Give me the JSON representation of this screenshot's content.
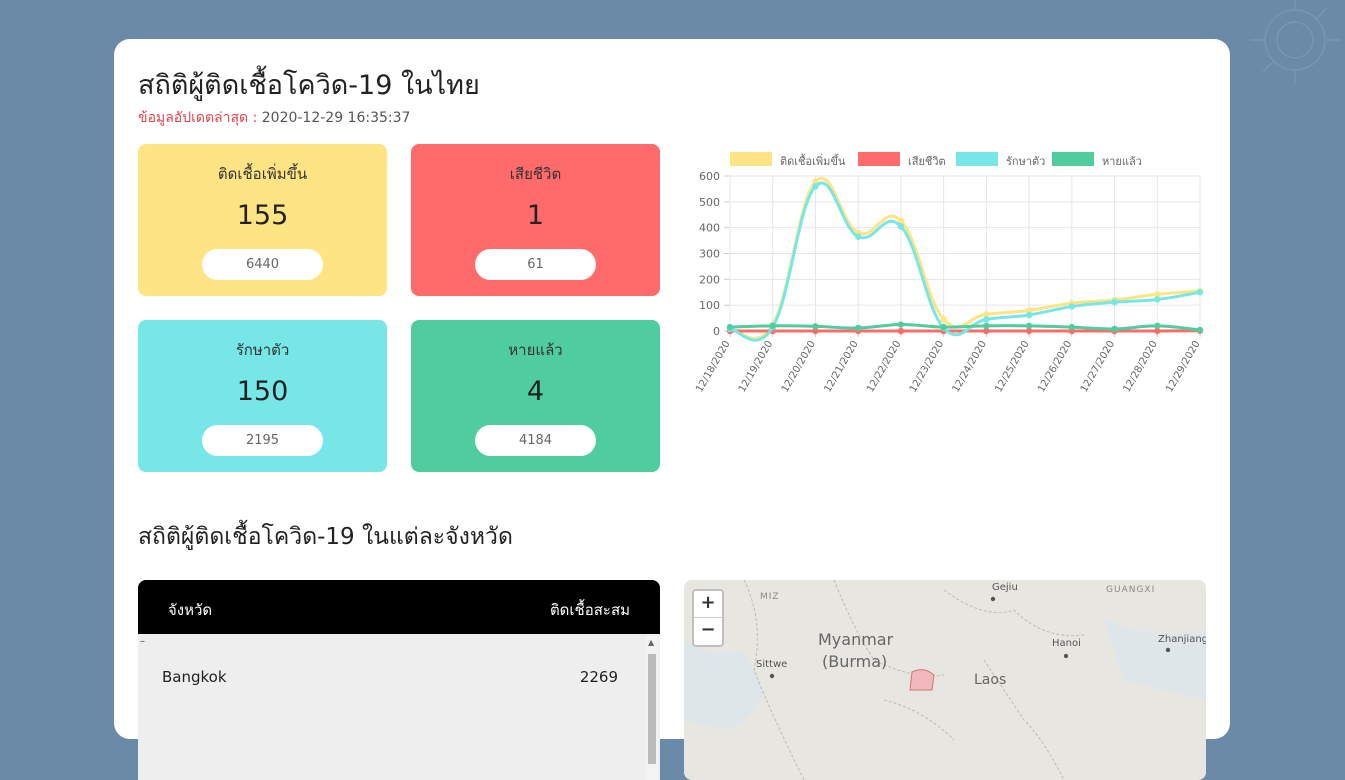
{
  "page": {
    "title": "สถิติผู้ติดเชื้อโควิด-19 ในไทย",
    "updated_label": "ข้อมูลอัปเดตล่าสุด :",
    "updated_value": "2020-12-29 16:35:37"
  },
  "stats": [
    {
      "label": "ติดเชื้อเพิ่มขึ้น",
      "value": "155",
      "total": "6440"
    },
    {
      "label": "เสียชีวิต",
      "value": "1",
      "total": "61"
    },
    {
      "label": "รักษาตัว",
      "value": "150",
      "total": "2195"
    },
    {
      "label": "หายแล้ว",
      "value": "4",
      "total": "4184"
    }
  ],
  "colors": {
    "infected": "#ffe483",
    "deaths": "#ff6b6b",
    "treating": "#76e7e6",
    "recovered": "#50cd9f"
  },
  "chart_data": {
    "type": "line",
    "categories": [
      "12/18/2020",
      "12/19/2020",
      "12/20/2020",
      "12/21/2020",
      "12/22/2020",
      "12/23/2020",
      "12/24/2020",
      "12/25/2020",
      "12/26/2020",
      "12/27/2020",
      "12/28/2020",
      "12/29/2020"
    ],
    "series": [
      {
        "name": "ติดเชื้อเพิ่มขึ้น",
        "color": "#ffe483",
        "values": [
          10,
          25,
          578,
          380,
          427,
          45,
          65,
          80,
          108,
          120,
          142,
          155
        ]
      },
      {
        "name": "เสียชีวิต",
        "color": "#ff6b6b",
        "values": [
          0,
          0,
          0,
          0,
          0,
          0,
          0,
          0,
          0,
          0,
          0,
          1
        ]
      },
      {
        "name": "รักษาตัว",
        "color": "#76e7e6",
        "values": [
          8,
          15,
          560,
          365,
          405,
          12,
          45,
          62,
          95,
          112,
          122,
          150
        ]
      },
      {
        "name": "หายแล้ว",
        "color": "#50cd9f",
        "values": [
          15,
          20,
          18,
          12,
          25,
          15,
          20,
          20,
          15,
          8,
          20,
          4
        ]
      }
    ],
    "ylim": [
      0,
      600
    ],
    "yticks": [
      "0",
      "100",
      "200",
      "300",
      "400",
      "500",
      "600"
    ],
    "grid": true,
    "legend_position": "top"
  },
  "section": {
    "title": "สถิติผู้ติดเชื้อโควิด-19 ในแต่ละจังหวัด"
  },
  "table": {
    "col1": "จังหวัด",
    "col2": "ติดเชื้อสะสม",
    "rows": [
      {
        "province": "Bangkok",
        "count": "2269"
      }
    ]
  },
  "map": {
    "zoom_in": "+",
    "zoom_out": "−",
    "labels": [
      "Myanmar",
      "(Burma)",
      "Gejiu",
      "GUANGXI",
      "Hanoi",
      "Zhanjiang",
      "Sittwe",
      "Laos",
      "MIZ"
    ]
  }
}
